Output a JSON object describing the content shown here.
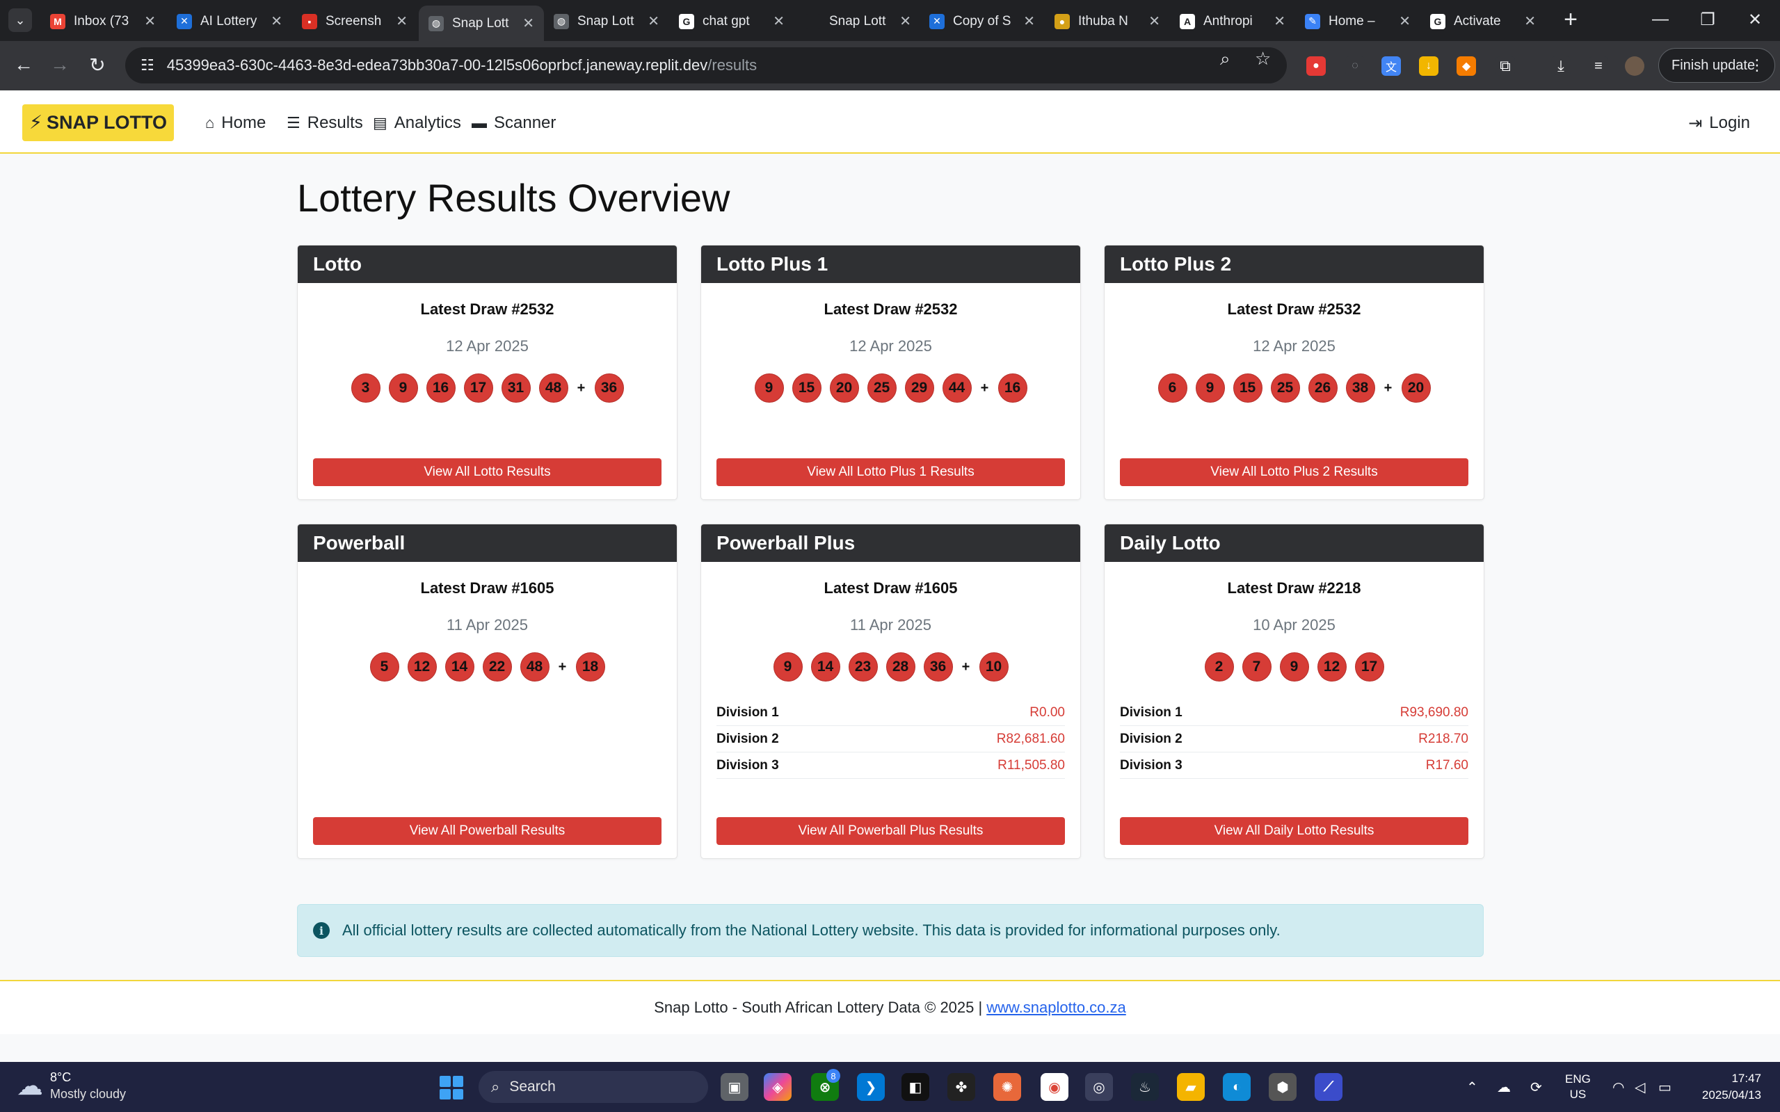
{
  "browser": {
    "tabs": [
      {
        "title": "Inbox (73",
        "icon": "gmail-icon",
        "color": "#ea4335",
        "glyph": "M"
      },
      {
        "title": "AI Lottery",
        "icon": "app-icon",
        "color": "#1e6fd9",
        "glyph": "✕"
      },
      {
        "title": "Screensh",
        "icon": "screenshot-icon",
        "color": "#d93025",
        "glyph": "▪"
      },
      {
        "title": "Snap Lott",
        "icon": "globe-icon",
        "color": "#5f6368",
        "glyph": "◍",
        "active": true
      },
      {
        "title": "Snap Lott",
        "icon": "globe-icon",
        "color": "#5f6368",
        "glyph": "◍"
      },
      {
        "title": "chat gpt",
        "icon": "google-icon",
        "color": "#ffffff",
        "glyph": "G"
      },
      {
        "title": "Snap Lott",
        "icon": "blank-icon",
        "color": "#202124",
        "glyph": ""
      },
      {
        "title": "Copy of S",
        "icon": "app-icon",
        "color": "#1e6fd9",
        "glyph": "✕"
      },
      {
        "title": "Ithuba N",
        "icon": "ithuba-icon",
        "color": "#d4a017",
        "glyph": "●"
      },
      {
        "title": "Anthropi",
        "icon": "anthropic-icon",
        "color": "#ffffff",
        "glyph": "A"
      },
      {
        "title": "Home –",
        "icon": "pen-icon",
        "color": "#3b82f6",
        "glyph": "✎"
      },
      {
        "title": "Activate",
        "icon": "google-icon",
        "color": "#ffffff",
        "glyph": "G"
      }
    ],
    "url_host": "45399ea3-630c-4463-8e3d-edea73bb30a7-00-12l5s06oprbcf.janeway.replit.dev",
    "url_path": "/results",
    "finish_update": "Finish update"
  },
  "nav": {
    "brand": "SNAP LOTTO",
    "links": [
      "Home",
      "Results",
      "Analytics",
      "Scanner"
    ],
    "login": "Login"
  },
  "page": {
    "title": "Lottery Results Overview"
  },
  "cards": [
    {
      "name": "Lotto",
      "draw": "Latest Draw #2532",
      "date": "12 Apr 2025",
      "numbers": [
        "3",
        "9",
        "16",
        "17",
        "31",
        "48"
      ],
      "bonus": "36",
      "divisions": [],
      "button": "View All Lotto Results"
    },
    {
      "name": "Lotto Plus 1",
      "draw": "Latest Draw #2532",
      "date": "12 Apr 2025",
      "numbers": [
        "9",
        "15",
        "20",
        "25",
        "29",
        "44"
      ],
      "bonus": "16",
      "divisions": [],
      "button": "View All Lotto Plus 1 Results"
    },
    {
      "name": "Lotto Plus 2",
      "draw": "Latest Draw #2532",
      "date": "12 Apr 2025",
      "numbers": [
        "6",
        "9",
        "15",
        "25",
        "26",
        "38"
      ],
      "bonus": "20",
      "divisions": [],
      "button": "View All Lotto Plus 2 Results"
    },
    {
      "name": "Powerball",
      "draw": "Latest Draw #1605",
      "date": "11 Apr 2025",
      "numbers": [
        "5",
        "12",
        "14",
        "22",
        "48"
      ],
      "bonus": "18",
      "divisions": [],
      "button": "View All Powerball Results"
    },
    {
      "name": "Powerball Plus",
      "draw": "Latest Draw #1605",
      "date": "11 Apr 2025",
      "numbers": [
        "9",
        "14",
        "23",
        "28",
        "36"
      ],
      "bonus": "10",
      "divisions": [
        {
          "name": "Division 1",
          "amount": "R0.00"
        },
        {
          "name": "Division 2",
          "amount": "R82,681.60"
        },
        {
          "name": "Division 3",
          "amount": "R11,505.80"
        }
      ],
      "button": "View All Powerball Plus Results"
    },
    {
      "name": "Daily Lotto",
      "draw": "Latest Draw #2218",
      "date": "10 Apr 2025",
      "numbers": [
        "2",
        "7",
        "9",
        "12",
        "17"
      ],
      "bonus": null,
      "divisions": [
        {
          "name": "Division 1",
          "amount": "R93,690.80"
        },
        {
          "name": "Division 2",
          "amount": "R218.70"
        },
        {
          "name": "Division 3",
          "amount": "R17.60"
        }
      ],
      "button": "View All Daily Lotto Results"
    }
  ],
  "alert": {
    "text": "All official lottery results are collected automatically from the National Lottery website. This data is provided for informational purposes only."
  },
  "footer": {
    "text": "Snap Lotto - South African Lottery Data © 2025 |",
    "link": "www.snaplotto.co.za"
  },
  "taskbar": {
    "temp": "8°C",
    "condition": "Mostly cloudy",
    "search": "Search",
    "badge": "8",
    "lang1": "ENG",
    "lang2": "US",
    "time": "17:47",
    "date": "2025/04/13"
  },
  "colors": {
    "brand_yellow": "#f7d93a",
    "ball_red": "#d63c36",
    "card_header": "#2f3033",
    "alert_bg": "#d1ecf1"
  }
}
